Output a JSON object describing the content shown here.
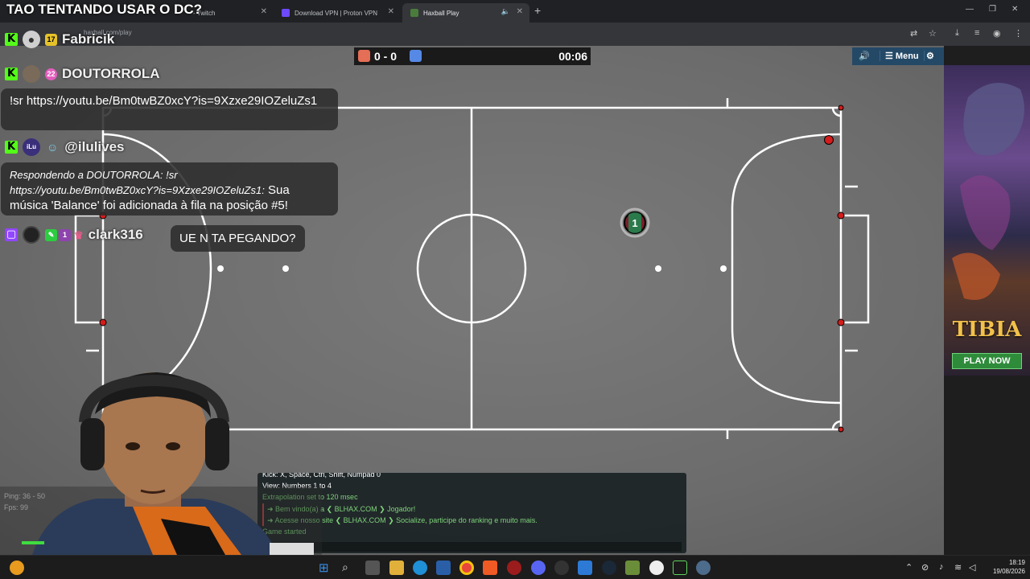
{
  "stream_title": "TAO TENTANDO USAR O DC?",
  "browser": {
    "tabs": [
      {
        "title": "- Twitch",
        "icon_color": "#9146ff"
      },
      {
        "title": "Download VPN | Proton VPN",
        "icon_color": "#6d4aff"
      },
      {
        "title": "Haxball Play",
        "icon_color": "#4a7d3b"
      }
    ],
    "url": "haxball.com/play"
  },
  "scoreboard": {
    "score": "0 - 0",
    "time": "00:06",
    "red_color": "#e56e56",
    "blue_color": "#5689e5"
  },
  "game_menu": {
    "menu_label": "Menu"
  },
  "player_number": "1",
  "stats": {
    "ping": "Ping: 36 - 50",
    "fps": "Fps: 99"
  },
  "game_chat": [
    {
      "text": "Kick: X, Space, Ctrl, Shift, Numpad 0",
      "style": "white"
    },
    {
      "text": "View: Numbers 1 to 4",
      "style": "white"
    },
    {
      "text": "Extrapolation set to 120 msec",
      "style": "green"
    },
    {
      "text": "➜ Bem vindo(a) a ❮ BLHAX.COM ❯ Jogador!",
      "style": "red"
    },
    {
      "text": "➜ Acesse nosso site ❮ BLHAX.COM ❯ Socialize, participe do ranking e muito mais.",
      "style": "red"
    },
    {
      "text": "Game started",
      "style": "green"
    }
  ],
  "overlay_chat": {
    "fabricik": {
      "badge": "17",
      "name": "Fabricik"
    },
    "doutorrola": {
      "badge": "22",
      "name": "DOUTORROLA",
      "message": "!sr https://youtu.be/Bm0twBZ0xcY?is=9Xzxe29IOZeluZs1"
    },
    "ilulives": {
      "avatar_text": "iLu",
      "name": "@ilulives",
      "reply_prefix": "Respondendo a DOUTORROLA: !sr https://youtu.be/Bm0twBZ0xcY?is=9Xzxe29IOZeluZs1:",
      "message": "Sua música 'Balance' foi adicionada à fila na posição #5!"
    },
    "clark": {
      "name": "clark316",
      "message": "UE N TA PEGANDO?"
    }
  },
  "ad": {
    "title": "TIBIA",
    "button": "PLAY NOW"
  },
  "taskbar": {
    "time": "18:19",
    "date": "19/08/2026"
  }
}
